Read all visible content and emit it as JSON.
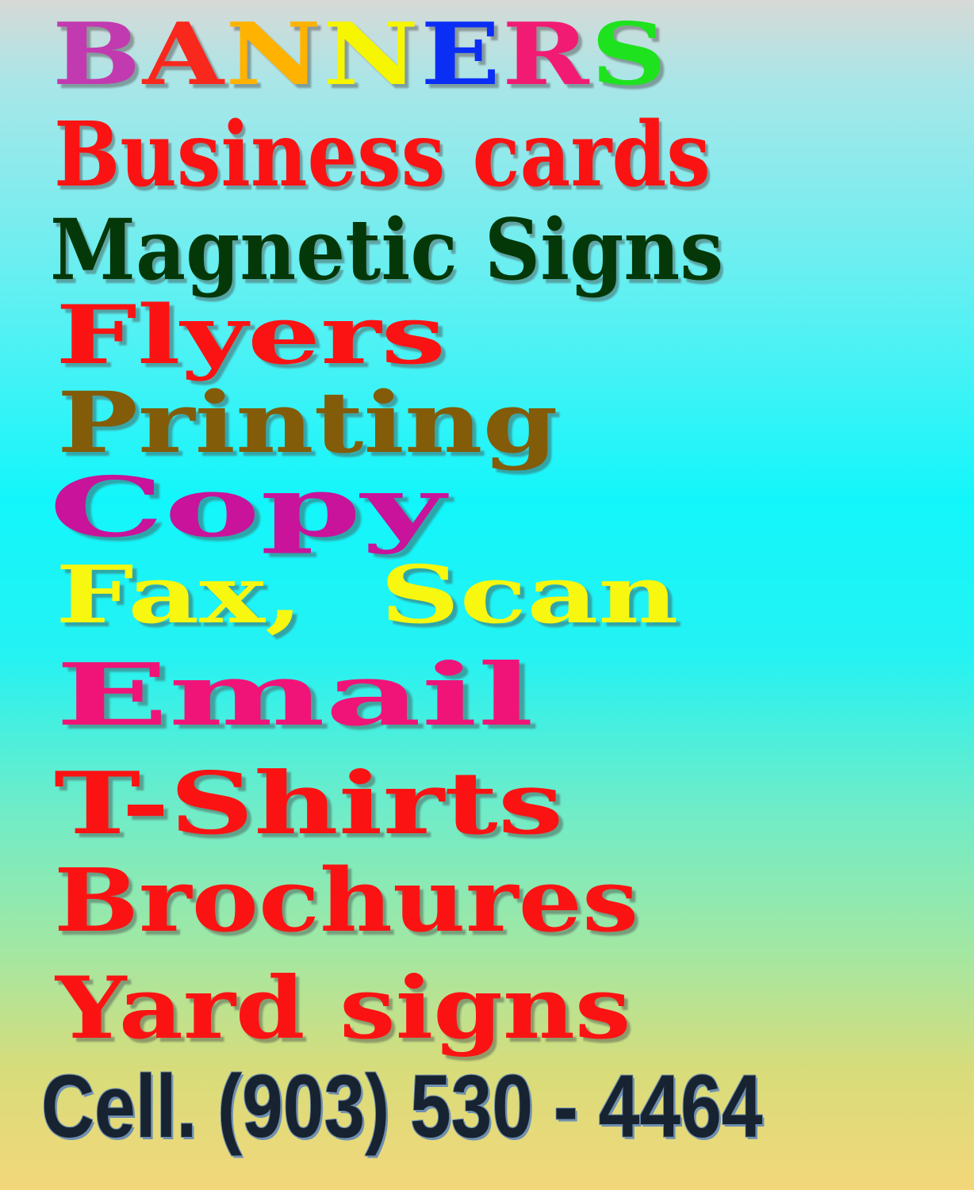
{
  "banners": {
    "letters": [
      {
        "char": "B",
        "color": "#c23ab0"
      },
      {
        "char": "A",
        "color": "#f8281d"
      },
      {
        "char": "N",
        "color": "#ffb300"
      },
      {
        "char": "N",
        "color": "#f6f600"
      },
      {
        "char": "E",
        "color": "#0b2ef5"
      },
      {
        "char": "R",
        "color": "#f21b74"
      },
      {
        "char": "S",
        "color": "#1fe21f"
      }
    ]
  },
  "services": {
    "business_cards": "Business cards",
    "magnetic_signs": "Magnetic Signs",
    "flyers": "Flyers",
    "printing": "Printing",
    "copy": "Copy",
    "fax_scan": "Fax,  Scan",
    "email": "Email",
    "tshirts": "T-Shirts",
    "brochures": "Brochures",
    "yard_signs": "Yard signs"
  },
  "contact": {
    "phone": "Cell. (903) 530 - 4464"
  }
}
